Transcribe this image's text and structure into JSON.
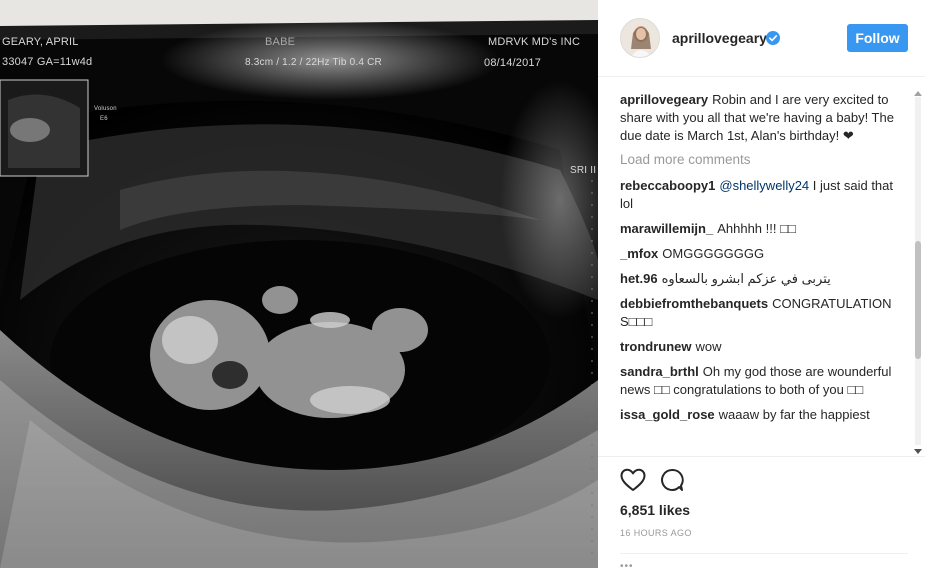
{
  "post": {
    "username": "aprillovegeary",
    "follow_label": "Follow",
    "caption_user": "aprillovegeary",
    "caption_text": "Robin and I are very excited to share with you all that we're having a baby! The due date is March 1st, Alan's birthday! ❤",
    "load_more_label": "Load more comments",
    "likes": "6,851 likes",
    "time": "16 HOURS AGO",
    "more_dots": "•••"
  },
  "comments": [
    {
      "user": "rebeccaboopy1",
      "mention": "@shellywelly24",
      "text": "I just said that lol"
    },
    {
      "user": "marawillemijn_",
      "text": "Ahhhhh !!! □□"
    },
    {
      "user": "_mfox",
      "text": "OMGGGGGGGG"
    },
    {
      "user": "het.96",
      "text": "يتربى في عزكم ابشرو بالسعاوه"
    },
    {
      "user": "debbiefromthebanquets",
      "text": "CONGRATULATIONS□□□"
    },
    {
      "user": "trondrunew",
      "text": "wow"
    },
    {
      "user": "sandra_brthl",
      "text": "Oh my god those are wounderful news □□ congratulations to both of you □□"
    },
    {
      "user": "issa_gold_rose",
      "text": "waaaw by far the happiest"
    }
  ],
  "ultrasound": {
    "patient": "GEARY, APRIL",
    "id_ga": "33047  GA=11w4d",
    "center": "BABE",
    "probe": "8.3cm / 1.2 / 22Hz   Tib 0.4   CR",
    "clinic": "MDRVK MD's INC",
    "date": "08/14/2017",
    "voluson": "Voluson",
    "e6": "E6",
    "sri": "SRI II"
  },
  "colors": {
    "follow_button": "#3897f0",
    "verified_badge": "#3897f0",
    "mention_link": "#003569",
    "muted_text": "#999999"
  },
  "icons": [
    "verified-badge-icon",
    "heart-icon",
    "comment-bubble-icon"
  ]
}
